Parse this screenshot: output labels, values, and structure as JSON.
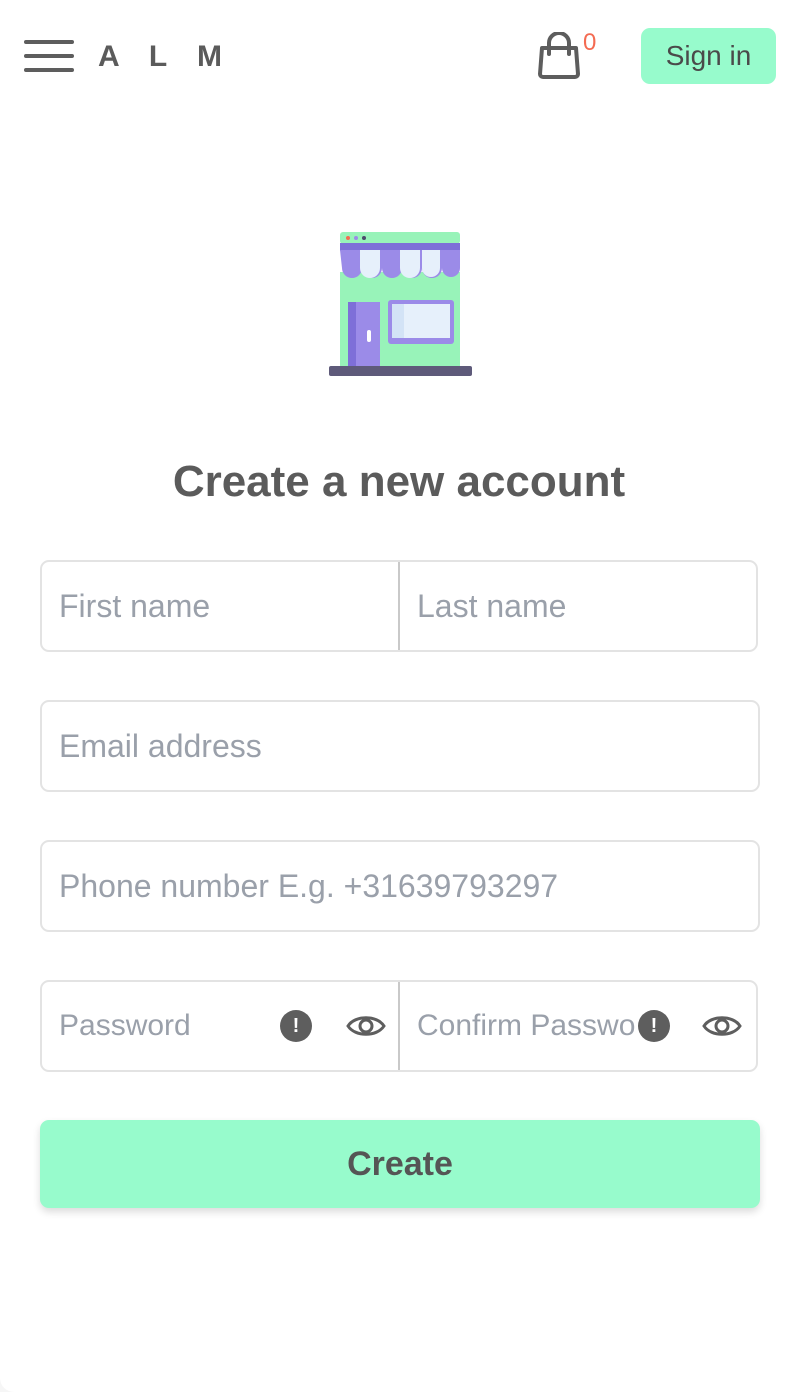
{
  "header": {
    "logo": "A L M",
    "cart_count": "0",
    "signin_label": "Sign in"
  },
  "main": {
    "title": "Create a new account",
    "fields": {
      "first_name_placeholder": "First name",
      "last_name_placeholder": "Last name",
      "email_placeholder": "Email address",
      "phone_placeholder": "Phone number E.g. +31639793297",
      "password_placeholder": "Password",
      "confirm_password_placeholder": "Confirm Password"
    },
    "create_label": "Create"
  },
  "icons": {
    "menu": "hamburger-menu-icon",
    "cart": "shopping-bag-icon",
    "illustration": "storefront-icon",
    "warning": "exclamation-circle-icon",
    "visibility": "eye-icon"
  },
  "colors": {
    "accent": "#97fbcc",
    "badge": "#f46b52",
    "text": "#5b5b5b",
    "placeholder": "#9aa0aa",
    "awning": "#9b8be8",
    "store_body": "#98f3b9"
  }
}
